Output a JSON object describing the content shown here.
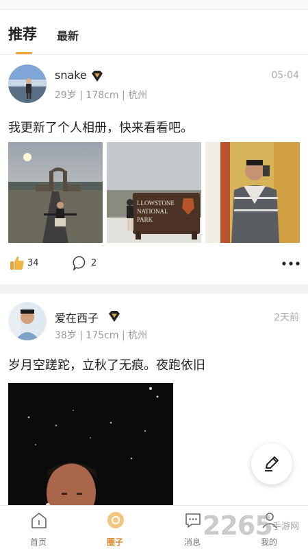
{
  "tabs": {
    "recommended": "推荐",
    "latest": "最新"
  },
  "posts": [
    {
      "username": "snake",
      "meta": "29岁 | 178cm | 杭州",
      "date": "05-04",
      "text": "我更新了个人相册，快来看看吧。",
      "likes": "34",
      "comments": "2",
      "photos": [
        "gate-road-photo",
        "yellowstone-sign-photo",
        "selfie-sweater-photo"
      ],
      "sign_text": [
        "LLOWSTONE",
        "NATIONAL",
        "PARK"
      ]
    },
    {
      "username": "爱在西子",
      "meta": "38岁 | 175cm | 杭州",
      "date": "2天前",
      "text": "岁月空蹉跎，立秋了无痕。夜跑依旧"
    }
  ],
  "bottom_nav": [
    {
      "label": "首页",
      "icon": "home-icon"
    },
    {
      "label": "圈子",
      "icon": "circle-icon"
    },
    {
      "label": "消息",
      "icon": "message-icon"
    },
    {
      "label": "我的",
      "icon": "user-icon"
    }
  ],
  "watermark": {
    "number": "2265",
    "text": "手游网"
  },
  "colors": {
    "accent": "#f2a33a",
    "active_nav": "#d68a2c"
  }
}
